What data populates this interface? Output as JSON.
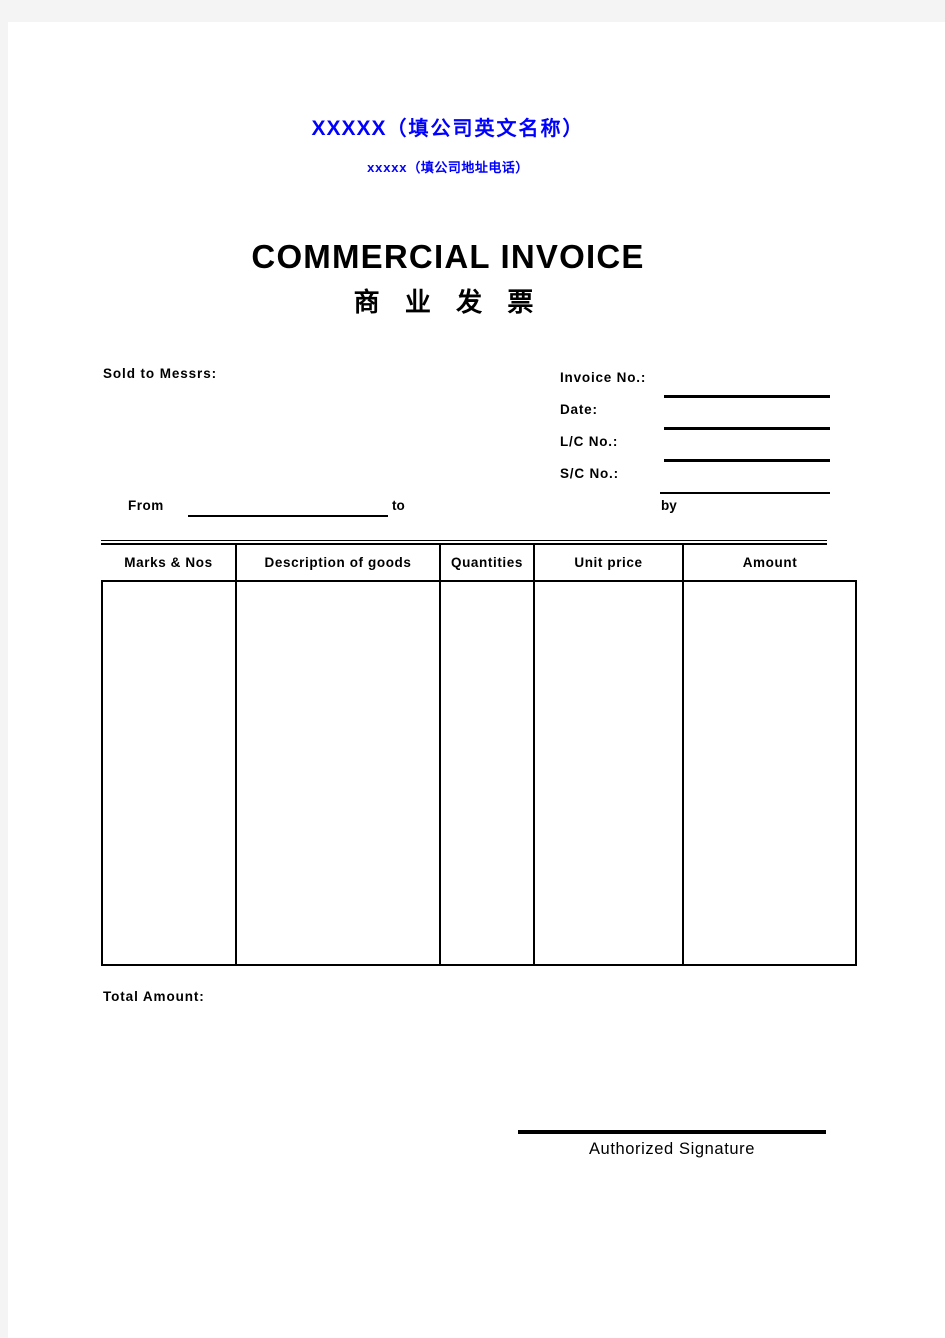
{
  "document": {
    "type": "commercial-invoice-template",
    "accent_color": "#0000ff",
    "text_color": "#000000",
    "page_background": "#ffffff"
  },
  "header": {
    "company_name_latin": "XXXXX",
    "company_name_cjk": "（填公司英文名称）",
    "company_address_latin": "xxxxx",
    "company_address_cjk": "（填公司地址电话）"
  },
  "title": {
    "english": "COMMERCIAL INVOICE",
    "chinese": "商 业 发 票"
  },
  "parties": {
    "sold_to_label": "Sold to Messrs:"
  },
  "references": [
    {
      "label": "Invoice No.:",
      "value": ""
    },
    {
      "label": "Date:",
      "value": ""
    },
    {
      "label": "L/C No.:",
      "value": ""
    },
    {
      "label": "S/C No.:",
      "value": ""
    }
  ],
  "shipment": {
    "from_label": "From",
    "from_value": "",
    "to_label": "to",
    "to_value": "",
    "by_label": "by",
    "by_value": ""
  },
  "goods_table": {
    "columns": [
      "Marks & Nos",
      "Description of goods",
      "Quantities",
      "Unit price",
      "Amount"
    ],
    "rows": []
  },
  "totals": {
    "total_amount_label": "Total Amount:",
    "total_amount_value": ""
  },
  "signature": {
    "label": "Authorized Signature",
    "value": ""
  }
}
